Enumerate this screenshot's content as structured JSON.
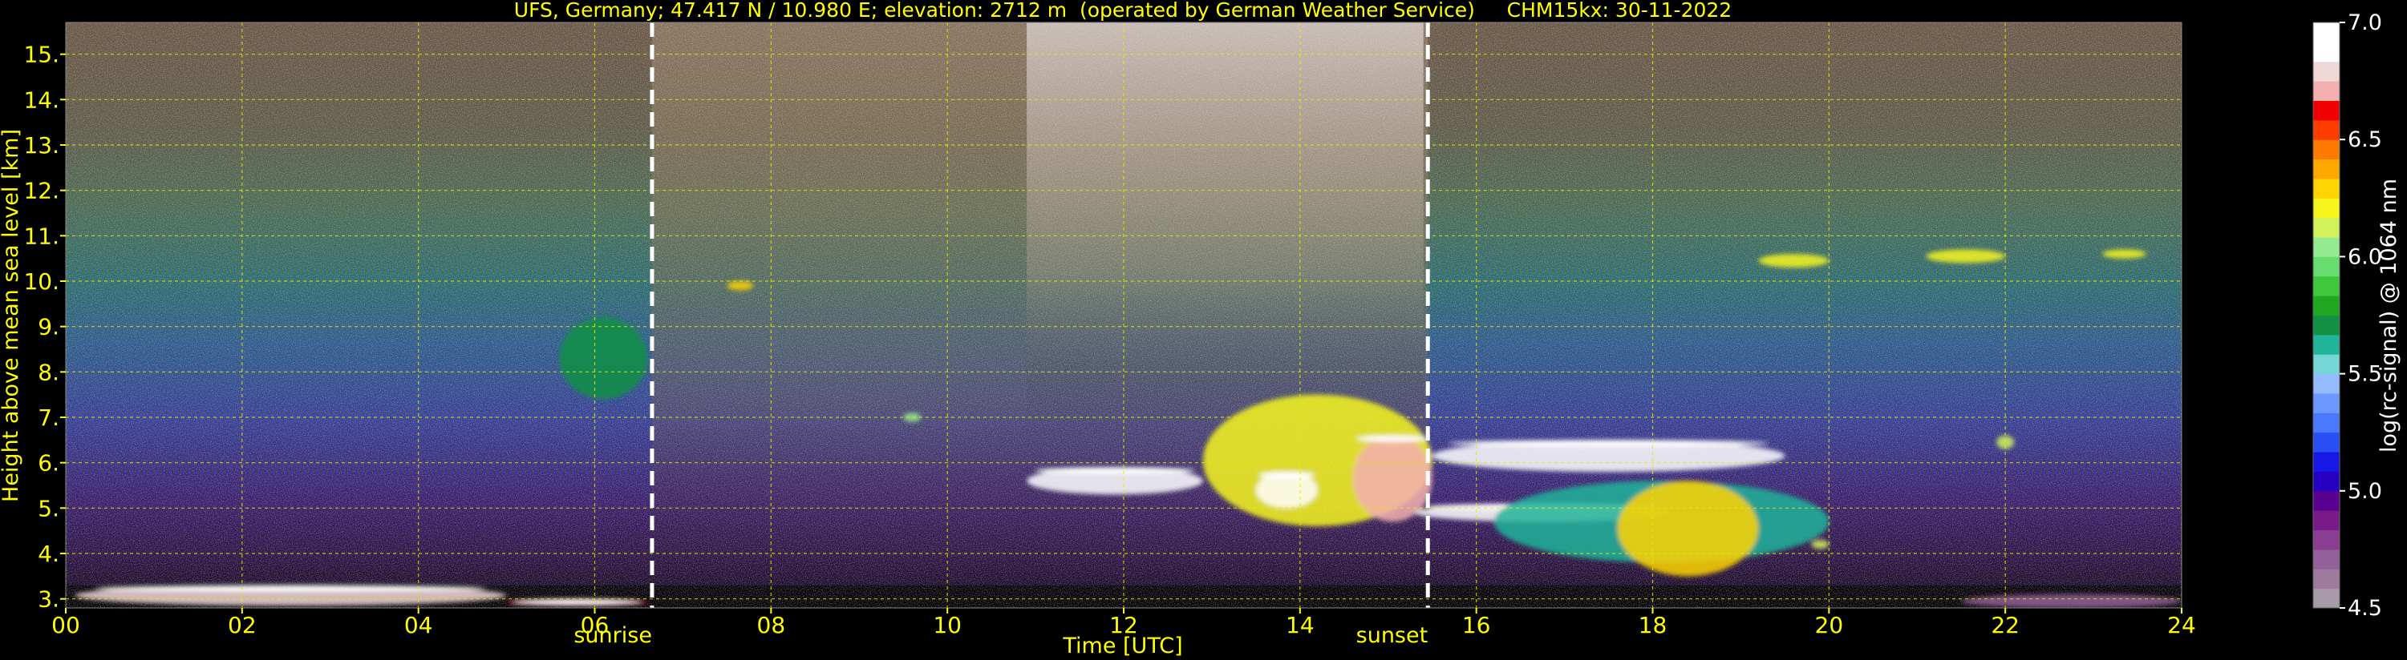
{
  "chart_data": {
    "type": "heatmap",
    "title": "UFS, Germany; 47.417 N / 10.980 E; elevation: 2712 m  (operated by German Weather Service)     CHM15kx: 30-11-2022",
    "xlabel": "Time [UTC]",
    "ylabel": "Height above mean sea level [km]",
    "xlim": [
      0,
      24
    ],
    "ylim": [
      2.8,
      15.7
    ],
    "xticks": [
      "00",
      "02",
      "04",
      "06",
      "08",
      "10",
      "12",
      "14",
      "16",
      "18",
      "20",
      "22",
      "24"
    ],
    "yticks": [
      "3.",
      "4.",
      "5.",
      "6.",
      "7.",
      "8.",
      "9.",
      "10.",
      "11.",
      "12.",
      "13.",
      "14.",
      "15."
    ],
    "grid": true,
    "annotations": [
      {
        "label": "sunrise",
        "x": 6.65
      },
      {
        "label": "sunset",
        "x": 15.45
      }
    ],
    "colorbar": {
      "label": "log(rc-signal) @ 1064 nm",
      "range": [
        4.5,
        7.0
      ],
      "ticks": [
        "4.5",
        "5.0",
        "5.5",
        "6.0",
        "6.5",
        "7.0"
      ],
      "colors": [
        "#a89aa8",
        "#9e7a9e",
        "#94609a",
        "#8a3d92",
        "#7a1a8a",
        "#5a0090",
        "#2600c0",
        "#1818e6",
        "#2a4ef5",
        "#4a78ff",
        "#6c98ff",
        "#94bcff",
        "#76d6d6",
        "#22b49a",
        "#129044",
        "#20a820",
        "#40c83c",
        "#68dc6e",
        "#94ea90",
        "#d2f25c",
        "#f6f61e",
        "#ffd400",
        "#ffa800",
        "#ff7a00",
        "#ff3c00",
        "#f00000",
        "#f4b0b0",
        "#f0d8d8",
        "#ffffff",
        "#ffffff"
      ]
    },
    "series": [
      {
        "name": "background_gradient",
        "heights": [
          3.0,
          4.0,
          5.0,
          6.0,
          7.0,
          8.0,
          9.0,
          10.0,
          11.0,
          12.0,
          13.0,
          14.0,
          15.0
        ],
        "values": [
          4.65,
          4.8,
          4.95,
          5.1,
          5.25,
          5.4,
          5.5,
          5.6,
          5.7,
          5.8,
          5.9,
          6.0,
          6.05
        ]
      },
      {
        "name": "cloud_layers",
        "points": [
          {
            "t0": 0.1,
            "t1": 5.0,
            "h0": 2.85,
            "h1": 3.3,
            "v": 6.8
          },
          {
            "t0": 5.0,
            "t1": 6.6,
            "h0": 2.85,
            "h1": 3.0,
            "v": 6.6
          },
          {
            "t0": 5.6,
            "t1": 6.6,
            "h0": 7.4,
            "h1": 9.2,
            "v": 5.7
          },
          {
            "t0": 7.5,
            "t1": 7.8,
            "h0": 9.8,
            "h1": 10.0,
            "v": 6.3
          },
          {
            "t0": 9.5,
            "t1": 9.7,
            "h0": 6.9,
            "h1": 7.1,
            "v": 6.0
          },
          {
            "t0": 10.9,
            "t1": 12.9,
            "h0": 5.3,
            "h1": 5.9,
            "v": 6.9
          },
          {
            "t0": 12.9,
            "t1": 15.5,
            "h0": 4.6,
            "h1": 7.5,
            "v": 6.2
          },
          {
            "t0": 13.5,
            "t1": 14.2,
            "h0": 5.0,
            "h1": 5.8,
            "v": 6.9
          },
          {
            "t0": 14.6,
            "t1": 15.5,
            "h0": 4.7,
            "h1": 6.6,
            "v": 6.7
          },
          {
            "t0": 15.3,
            "t1": 18.2,
            "h0": 4.7,
            "h1": 5.1,
            "v": 6.9
          },
          {
            "t0": 15.5,
            "t1": 19.5,
            "h0": 5.8,
            "h1": 6.5,
            "v": 6.9
          },
          {
            "t0": 16.2,
            "t1": 20.0,
            "h0": 3.8,
            "h1": 5.6,
            "v": 5.6
          },
          {
            "t0": 17.6,
            "t1": 19.2,
            "h0": 3.5,
            "h1": 5.6,
            "v": 6.3
          },
          {
            "t0": 19.8,
            "t1": 20.0,
            "h0": 4.1,
            "h1": 4.3,
            "v": 6.1
          },
          {
            "t0": 19.2,
            "t1": 20.0,
            "h0": 10.3,
            "h1": 10.6,
            "v": 6.2
          },
          {
            "t0": 21.1,
            "t1": 22.0,
            "h0": 10.4,
            "h1": 10.7,
            "v": 6.2
          },
          {
            "t0": 23.1,
            "t1": 23.6,
            "h0": 10.5,
            "h1": 10.7,
            "v": 6.2
          },
          {
            "t0": 21.9,
            "t1": 22.1,
            "h0": 6.3,
            "h1": 6.6,
            "v": 6.1
          },
          {
            "t0": 21.5,
            "t1": 24.0,
            "h0": 2.8,
            "h1": 3.1,
            "v": 4.7
          }
        ]
      }
    ]
  }
}
